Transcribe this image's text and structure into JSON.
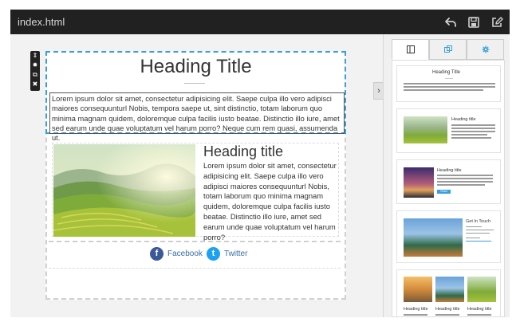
{
  "window": {
    "title": "index.html"
  },
  "toolbar": {
    "icons": [
      "undo-icon",
      "save-icon",
      "edit-icon"
    ]
  },
  "block_tools": {
    "icons": [
      "move-icon",
      "settings-icon",
      "duplicate-icon",
      "delete-icon"
    ]
  },
  "hero": {
    "heading": "Heading Title",
    "paragraph": "Lorem ipsum dolor sit amet, consectetur adipisicing elit. Saepe culpa illo vero adipisci maiores consequunturl Nobis, tempora saepe ut, sint distinctio, totam laborum quo minima magnam quidem, doloremque culpa facilis iusto beatae. Distinctio illo iure, amet sed earum unde quae voluptatum vel harum porro? Neque cum rem quasi, assumenda ut."
  },
  "feature": {
    "heading": "Heading title",
    "paragraph": "Lorem ipsum dolor sit amet, consectetur adipisicing elit. Saepe culpa illo vero adipisci maiores consequunturl Nobis, totam laborum quo minima magnam quidem, doloremque culpa facilis iusto beatae. Distinctio illo iure, amet sed earum unde quae voluptatum vel harum porro?"
  },
  "social": {
    "facebook_label": "Facebook",
    "twitter_label": "Twitter",
    "facebook_color": "#3b5998",
    "twitter_color": "#1da1f2"
  },
  "sidebar": {
    "tabs": [
      "blocks-tab",
      "duplicate-tab",
      "settings-tab"
    ],
    "thumbnails": {
      "heading_title": "Heading Title",
      "heading_title_small": "Heading title",
      "get_in_touch": "Get In Touch",
      "read_more": "Read more"
    }
  },
  "colors": {
    "accent": "#3aa0d8",
    "topbar": "#212121"
  }
}
